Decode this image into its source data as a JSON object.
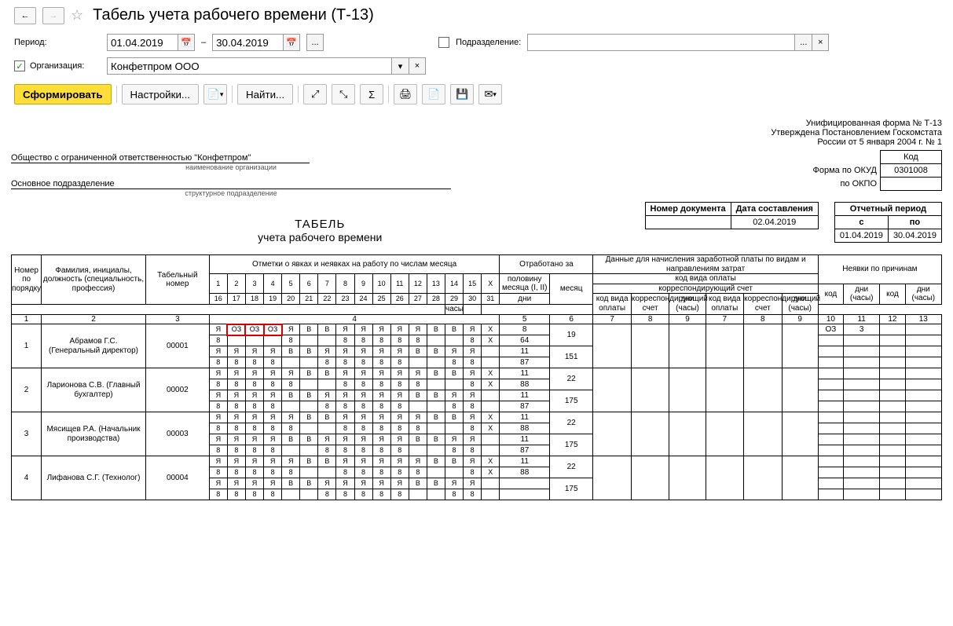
{
  "title": "Табель учета рабочего времени (Т-13)",
  "filters": {
    "period_label": "Период:",
    "from": "01.04.2019",
    "to": "30.04.2019",
    "dash": "–",
    "ellipsis": "...",
    "org_label": "Организация:",
    "org_value": "Конфетпром ООО",
    "div_label": "Подразделение:",
    "div_value": "",
    "org_check": "✓"
  },
  "toolbar": {
    "generate": "Сформировать",
    "settings": "Настройки...",
    "find": "Найти..."
  },
  "report": {
    "form_line1": "Унифицированная форма № Т-13",
    "form_line2": "Утверждена Постановлением Госкомстата",
    "form_line3": "России от 5 января 2004 г. № 1",
    "kod_label": "Код",
    "okud_label": "Форма по ОКУД",
    "okud_value": "0301008",
    "okpo_label": "по ОКПО",
    "okpo_value": "",
    "company": "Общество с ограниченной ответственностью \"Конфетпром\"",
    "company_sub": "наименование организации",
    "division": "Основное подразделение",
    "division_sub": "структурное подразделение",
    "doc_num_label": "Номер документа",
    "doc_num": "",
    "doc_date_label": "Дата составления",
    "doc_date": "02.04.2019",
    "period_label": "Отчетный период",
    "period_from_label": "с",
    "period_to_label": "по",
    "period_from": "01.04.2019",
    "period_to": "30.04.2019",
    "title1": "ТАБЕЛЬ",
    "title2": "учета  рабочего времени"
  },
  "columns": {
    "c1": "Номер по порядку",
    "c2": "Фамилия, инициалы, должность (специальность, профессия)",
    "c3": "Табельный номер",
    "c4": "Отметки о явках и неявках на работу по числам месяца",
    "c5": "Отработано за",
    "c51": "половину месяца (I, II)",
    "c52": "месяц",
    "c53": "дни",
    "c54": "часы",
    "c6": "Данные для начисления заработной платы по видам и направлениям затрат",
    "c61": "код вида оплаты",
    "c62": "корреспондирующий счет",
    "c63": "код вида оплаты",
    "c64": "корреспондирующий счет",
    "c65": "дни (часы)",
    "c7": "Неявки по причинам",
    "c71": "код",
    "c72": "дни (часы)"
  },
  "days1": [
    "1",
    "2",
    "3",
    "4",
    "5",
    "6",
    "7",
    "8",
    "9",
    "10",
    "11",
    "12",
    "13",
    "14",
    "15",
    "X"
  ],
  "days2": [
    "16",
    "17",
    "18",
    "19",
    "20",
    "21",
    "22",
    "23",
    "24",
    "25",
    "26",
    "27",
    "28",
    "29",
    "30",
    "31"
  ],
  "colnums": [
    "1",
    "2",
    "3",
    "4",
    "5",
    "6",
    "7",
    "8",
    "9",
    "7",
    "8",
    "9",
    "10",
    "11",
    "12",
    "13"
  ],
  "employees": [
    {
      "n": "1",
      "name": "Абрамов Г.С. (Генеральный директор)",
      "num": "00001",
      "r1": [
        "Я",
        "ОЗ",
        "ОЗ",
        "ОЗ",
        "Я",
        "В",
        "В",
        "Я",
        "Я",
        "Я",
        "Я",
        "Я",
        "В",
        "В",
        "Я",
        "X"
      ],
      "r2": [
        "8",
        "",
        "",
        "",
        "8",
        "",
        "",
        "8",
        "8",
        "8",
        "8",
        "8",
        "",
        "",
        "8",
        "X"
      ],
      "r3": [
        "Я",
        "Я",
        "Я",
        "Я",
        "В",
        "В",
        "Я",
        "Я",
        "Я",
        "Я",
        "Я",
        "В",
        "В",
        "Я",
        "Я",
        ""
      ],
      "r4": [
        "8",
        "8",
        "8",
        "8",
        "",
        "",
        "8",
        "8",
        "8",
        "8",
        "8",
        "",
        "",
        "8",
        "8",
        ""
      ],
      "d1": "8",
      "d2": "64",
      "d3": "11",
      "d4": "87",
      "m1": "19",
      "m2": "151",
      "abs_code": "ОЗ",
      "abs_days": "3"
    },
    {
      "n": "2",
      "name": "Ларионова С.В. (Главный бухгалтер)",
      "num": "00002",
      "r1": [
        "Я",
        "Я",
        "Я",
        "Я",
        "Я",
        "В",
        "В",
        "Я",
        "Я",
        "Я",
        "Я",
        "Я",
        "В",
        "В",
        "Я",
        "X"
      ],
      "r2": [
        "8",
        "8",
        "8",
        "8",
        "8",
        "",
        "",
        "8",
        "8",
        "8",
        "8",
        "8",
        "",
        "",
        "8",
        "X"
      ],
      "r3": [
        "Я",
        "Я",
        "Я",
        "Я",
        "В",
        "В",
        "Я",
        "Я",
        "Я",
        "Я",
        "Я",
        "В",
        "В",
        "Я",
        "Я",
        ""
      ],
      "r4": [
        "8",
        "8",
        "8",
        "8",
        "",
        "",
        "8",
        "8",
        "8",
        "8",
        "8",
        "",
        "",
        "8",
        "8",
        ""
      ],
      "d1": "11",
      "d2": "88",
      "d3": "11",
      "d4": "87",
      "m1": "22",
      "m2": "175",
      "abs_code": "",
      "abs_days": ""
    },
    {
      "n": "3",
      "name": "Мясищев Р.А. (Начальник производства)",
      "num": "00003",
      "r1": [
        "Я",
        "Я",
        "Я",
        "Я",
        "Я",
        "В",
        "В",
        "Я",
        "Я",
        "Я",
        "Я",
        "Я",
        "В",
        "В",
        "Я",
        "X"
      ],
      "r2": [
        "8",
        "8",
        "8",
        "8",
        "8",
        "",
        "",
        "8",
        "8",
        "8",
        "8",
        "8",
        "",
        "",
        "8",
        "X"
      ],
      "r3": [
        "Я",
        "Я",
        "Я",
        "Я",
        "В",
        "В",
        "Я",
        "Я",
        "Я",
        "Я",
        "Я",
        "В",
        "В",
        "Я",
        "Я",
        ""
      ],
      "r4": [
        "8",
        "8",
        "8",
        "8",
        "",
        "",
        "8",
        "8",
        "8",
        "8",
        "8",
        "",
        "",
        "8",
        "8",
        ""
      ],
      "d1": "11",
      "d2": "88",
      "d3": "11",
      "d4": "87",
      "m1": "22",
      "m2": "175",
      "abs_code": "",
      "abs_days": ""
    },
    {
      "n": "4",
      "name": "Лифанова С.Г. (Технолог)",
      "num": "00004",
      "r1": [
        "Я",
        "Я",
        "Я",
        "Я",
        "Я",
        "В",
        "В",
        "Я",
        "Я",
        "Я",
        "Я",
        "Я",
        "В",
        "В",
        "Я",
        "X"
      ],
      "r2": [
        "8",
        "8",
        "8",
        "8",
        "8",
        "",
        "",
        "8",
        "8",
        "8",
        "8",
        "8",
        "",
        "",
        "8",
        "X"
      ],
      "r3": [
        "Я",
        "Я",
        "Я",
        "Я",
        "В",
        "В",
        "Я",
        "Я",
        "Я",
        "Я",
        "Я",
        "В",
        "В",
        "Я",
        "Я",
        ""
      ],
      "r4": [
        "8",
        "8",
        "8",
        "8",
        "",
        "",
        "8",
        "8",
        "8",
        "8",
        "8",
        "",
        "",
        "8",
        "8",
        ""
      ],
      "d1": "11",
      "d2": "88",
      "d3": "",
      "d4": "",
      "m1": "22",
      "m2": "175",
      "abs_code": "",
      "abs_days": ""
    }
  ]
}
